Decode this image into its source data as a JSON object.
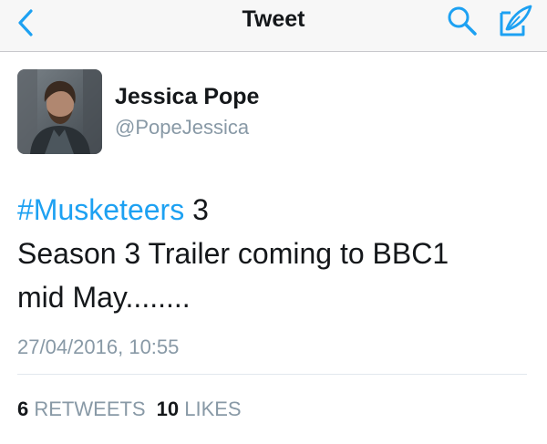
{
  "nav": {
    "title": "Tweet",
    "back_icon": "chevron-left-icon",
    "search_icon": "search-icon",
    "compose_icon": "compose-icon",
    "accent_color": "#1da1f2"
  },
  "tweet": {
    "author_name": "Jessica Pope",
    "author_handle": "@PopeJessica",
    "hashtag": "#Musketeers",
    "text_after_hashtag": " 3",
    "line2": "Season 3 Trailer coming to BBC1",
    "line3": "mid May........",
    "timestamp": "27/04/2016, 10:55"
  },
  "stats": {
    "retweets_count": "6",
    "retweets_label": "RETWEETS",
    "likes_count": "10",
    "likes_label": "LIKES"
  }
}
